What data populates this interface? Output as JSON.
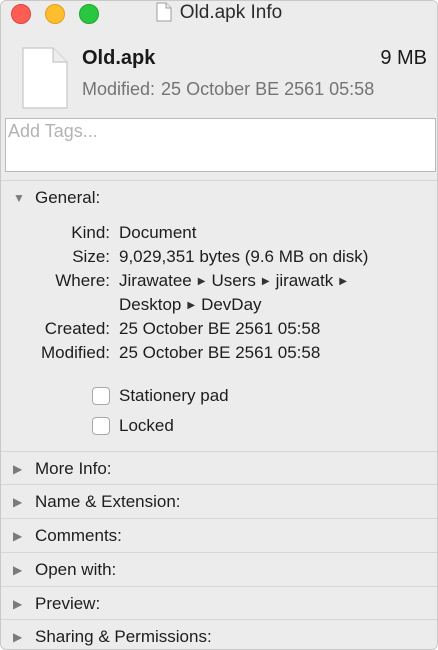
{
  "window": {
    "title": "Old.apk Info"
  },
  "header": {
    "file_name": "Old.apk",
    "file_size": "9 MB",
    "modified_prefix": "Modified:",
    "modified_value": "25 October BE 2561 05:58"
  },
  "tags": {
    "placeholder": "Add Tags..."
  },
  "general": {
    "title": "General:",
    "kind_label": "Kind:",
    "kind_value": "Document",
    "size_label": "Size:",
    "size_value": "9,029,351 bytes (9.6 MB on disk)",
    "where_label": "Where:",
    "where_path": [
      "Jirawatee",
      "Users",
      "jirawatk",
      "Desktop",
      "DevDay"
    ],
    "created_label": "Created:",
    "created_value": "25 October BE 2561 05:58",
    "modified_label": "Modified:",
    "modified_value": "25 October BE 2561 05:58",
    "stationery_label": "Stationery pad",
    "locked_label": "Locked"
  },
  "sections": {
    "more_info": "More Info:",
    "name_extension": "Name & Extension:",
    "comments": "Comments:",
    "open_with": "Open with:",
    "preview": "Preview:",
    "sharing": "Sharing & Permissions:"
  },
  "icons": {
    "close": "close-window-icon",
    "minimize": "minimize-window-icon",
    "zoom": "zoom-window-icon",
    "document": "document-icon",
    "disclosure_open": "disclosure-triangle-down-icon",
    "disclosure_closed": "disclosure-triangle-right-icon",
    "path_separator": "path-arrow-icon"
  },
  "colors": {
    "close": "#fd5d54",
    "minimize": "#fdbd2d",
    "zoom": "#29c63f",
    "window_bg": "#ececec"
  }
}
